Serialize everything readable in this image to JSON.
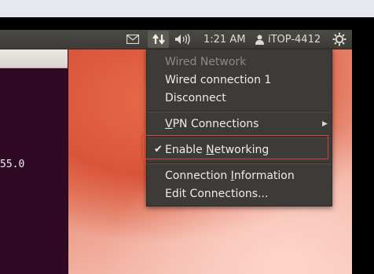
{
  "panel": {
    "time": "1:21 AM",
    "user": "iTOP-4412",
    "icons": {
      "mail": "mail-icon",
      "network": "network-updown-icon",
      "volume": "volume-icon",
      "user": "person-icon",
      "session": "gear-icon"
    }
  },
  "terminal": {
    "visible_text": "55.0"
  },
  "network_menu": {
    "header": "Wired Network",
    "wired_connection": "Wired connection 1",
    "disconnect": "Disconnect",
    "vpn_connections": {
      "mnemonic": "V",
      "rest": "PN Connections"
    },
    "enable_networking": {
      "before": "Enable ",
      "mnemonic": "N",
      "after": "etworking",
      "checked": true
    },
    "connection_information": {
      "before": "Connection ",
      "mnemonic": "I",
      "after": "nformation"
    },
    "edit_connections": "Edit Connections..."
  },
  "colors": {
    "panel": "#3d3c38",
    "menu_bg": "#3c3b37",
    "highlight_box": "#d9403a",
    "terminal_bg": "#300a24"
  }
}
